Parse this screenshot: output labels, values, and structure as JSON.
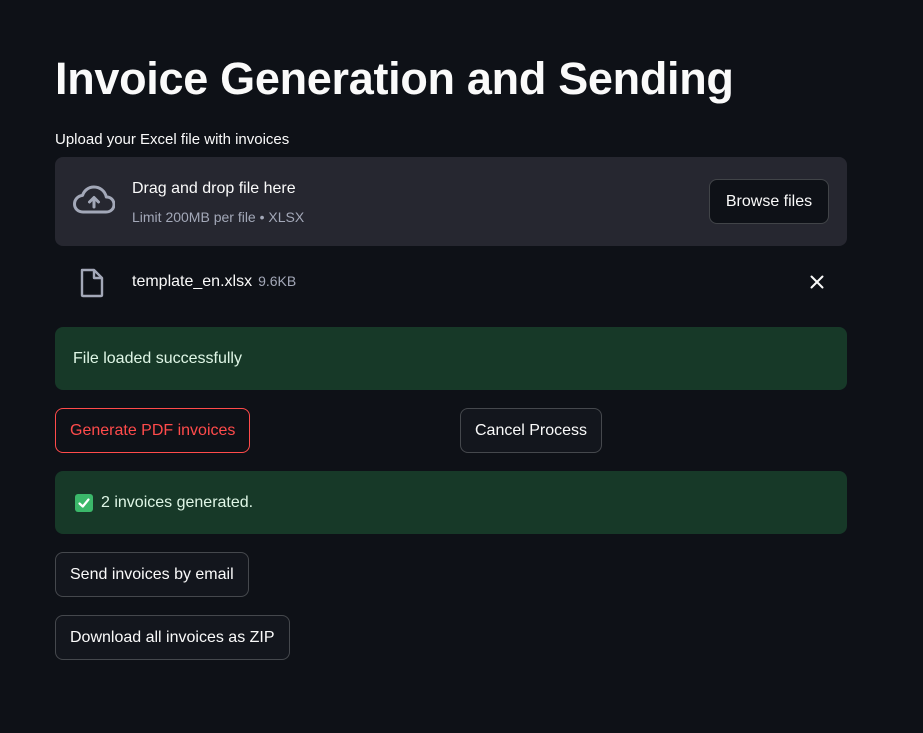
{
  "page": {
    "title": "Invoice Generation and Sending"
  },
  "uploader": {
    "label": "Upload your Excel file with invoices",
    "drop_title": "Drag and drop file here",
    "limit_text": "Limit 200MB per file • XLSX",
    "browse_label": "Browse files",
    "upload_icon": "cloud-upload-icon"
  },
  "file": {
    "name": "template_en.xlsx",
    "size": "9.6KB",
    "file_icon": "file-icon",
    "remove_icon": "close-icon"
  },
  "alerts": {
    "loaded": "File loaded successfully",
    "generated": "2 invoices generated.",
    "generated_icon": "check-mark-button-icon"
  },
  "actions": {
    "generate_label": "Generate PDF invoices",
    "cancel_label": "Cancel Process",
    "email_label": "Send invoices by email",
    "zip_label": "Download all invoices as ZIP"
  },
  "colors": {
    "background": "#0e1117",
    "dropzone": "#262730",
    "success_bg": "#173928",
    "primary": "#ff4b4b"
  }
}
